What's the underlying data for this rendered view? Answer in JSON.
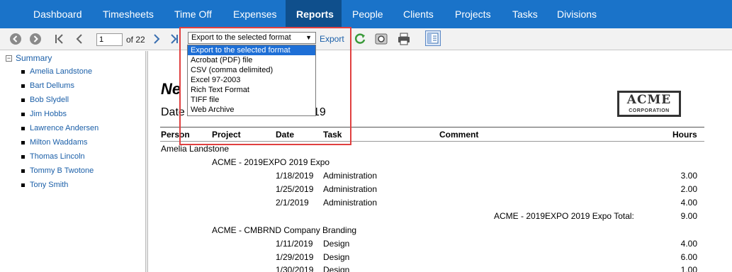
{
  "nav": {
    "items": [
      "Dashboard",
      "Timesheets",
      "Time Off",
      "Expenses",
      "Reports",
      "People",
      "Clients",
      "Projects",
      "Tasks",
      "Divisions"
    ],
    "active": "Reports"
  },
  "toolbar": {
    "page_value": "1",
    "page_of": "of 22",
    "export_selected": "Export to the selected format",
    "export_link": "Export"
  },
  "export_dropdown": {
    "options": [
      "Export to the selected format",
      "Acrobat (PDF) file",
      "CSV (comma delimited)",
      "Excel 97-2003",
      "Rich Text Format",
      "TIFF file",
      "Web Archive"
    ],
    "selected_index": 0
  },
  "sidebar": {
    "root": "Summary",
    "items": [
      "Amelia Landstone",
      "Bart Dellums",
      "Bob Slydell",
      "Jim Hobbs",
      "Lawrence Andersen",
      "Milton Waddams",
      "Thomas Lincoln",
      "Tommy B Twotone",
      "Tony Smith"
    ]
  },
  "report": {
    "title_visible": "Ne",
    "daterange_left": "Date",
    "daterange_right": "19",
    "logo": {
      "line1": "ACME",
      "line2": "CORPORATION"
    },
    "headers": {
      "person": "Person",
      "project": "Project",
      "date": "Date",
      "task": "Task",
      "comment": "Comment",
      "hours": "Hours"
    },
    "person": "Amelia Landstone",
    "projects": [
      {
        "name": "ACME - 2019EXPO  2019 Expo",
        "rows": [
          {
            "date": "1/18/2019",
            "task": "Administration",
            "hours": "3.00"
          },
          {
            "date": "1/25/2019",
            "task": "Administration",
            "hours": "2.00"
          },
          {
            "date": "2/1/2019",
            "task": "Administration",
            "hours": "4.00"
          }
        ],
        "total_label": "ACME - 2019EXPO  2019 Expo Total:",
        "total": "9.00"
      },
      {
        "name": "ACME - CMBRND  Company Branding",
        "rows": [
          {
            "date": "1/11/2019",
            "task": "Design",
            "hours": "4.00"
          },
          {
            "date": "1/29/2019",
            "task": "Design",
            "hours": "6.00"
          },
          {
            "date": "1/30/2019",
            "task": "Design",
            "hours": "1.00"
          }
        ]
      }
    ]
  },
  "colors": {
    "nav_bg": "#1a73c9",
    "nav_active_bg": "#0f4f8c",
    "link": "#1b5fa8",
    "dropdown_selected": "#1e6fd6",
    "highlight": "#e04040"
  }
}
